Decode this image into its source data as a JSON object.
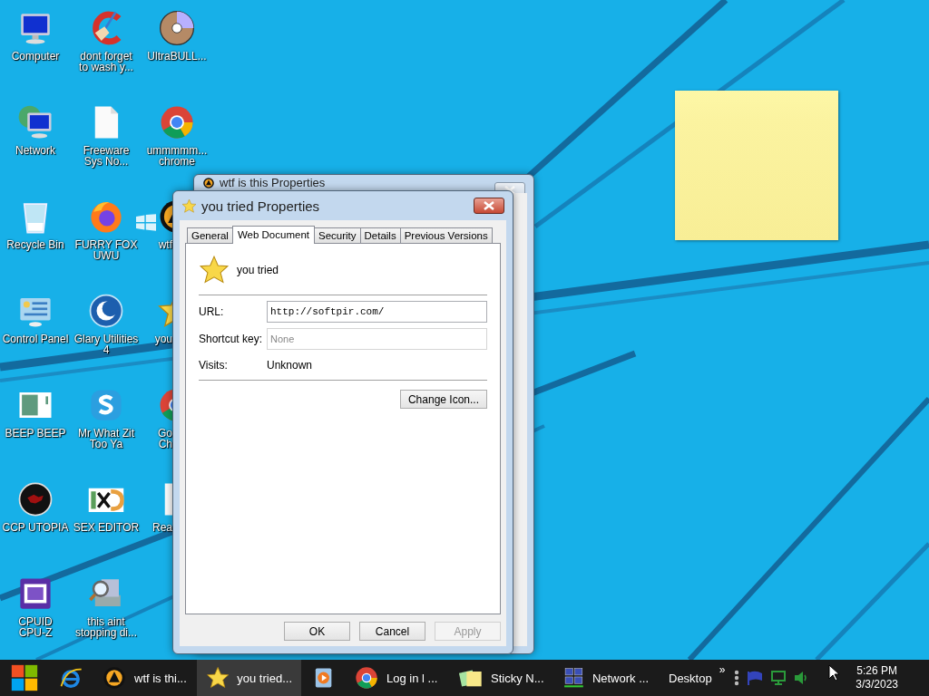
{
  "desktop_icons": [
    {
      "label": "Computer"
    },
    {
      "label": "Network"
    },
    {
      "label": "Recycle Bin"
    },
    {
      "label": "Control Panel"
    },
    {
      "label": "BEEP BEEP"
    },
    {
      "label": "CCP UTOPIA"
    },
    {
      "label": "CPUID\nCPU-Z"
    },
    {
      "label": "dont forget\nto wash y..."
    },
    {
      "label": "Freeware\nSys No..."
    },
    {
      "label": "FURRY FOX\nUWU"
    },
    {
      "label": "Glary Utilities\n4"
    },
    {
      "label": "Mr What Zit\nToo Ya"
    },
    {
      "label": "SEX EDITOR"
    },
    {
      "label": "this aint\nstopping di..."
    },
    {
      "label": "UltraBULL..."
    },
    {
      "label": "ummmmm...\nchrome"
    },
    {
      "label": "wtf"
    },
    {
      "label": "you"
    },
    {
      "label": "Go\nCh"
    },
    {
      "label": "Rea"
    }
  ],
  "back_window": {
    "title": "wtf is this Properties"
  },
  "dialog": {
    "title": "you tried Properties",
    "tabs": [
      {
        "label": "General",
        "selected": false
      },
      {
        "label": "Web Document",
        "selected": true
      },
      {
        "label": "Security",
        "selected": false
      },
      {
        "label": "Details",
        "selected": false
      },
      {
        "label": "Previous Versions",
        "selected": false
      }
    ],
    "name": "you tried",
    "fields": [
      {
        "label": "URL:",
        "value": "http://softpir.com/",
        "disabled": false
      },
      {
        "label": "Shortcut key:",
        "value": "None",
        "disabled": true
      }
    ],
    "visits_label": "Visits:",
    "visits": "Unknown",
    "change_icon": "Change Icon...",
    "buttons": [
      {
        "label": "OK",
        "disabled": false
      },
      {
        "label": "Cancel",
        "disabled": false
      },
      {
        "label": "Apply",
        "disabled": true
      }
    ]
  },
  "taskbar": {
    "items": [
      {
        "selected": false
      },
      {
        "selected": false
      },
      {
        "label": "wtf is thi...",
        "selected": false
      },
      {
        "label": "you tried...",
        "selected": true
      },
      {
        "selected": false
      },
      {
        "label": "Log in l ...",
        "selected": false
      },
      {
        "label": "Sticky N...",
        "selected": false
      },
      {
        "label": "Network ...",
        "selected": false
      }
    ],
    "toolbar": {
      "label": "Desktop",
      "chevron": "»"
    },
    "clock": {
      "time": "5:26 PM",
      "date": "3/3/2023"
    }
  }
}
